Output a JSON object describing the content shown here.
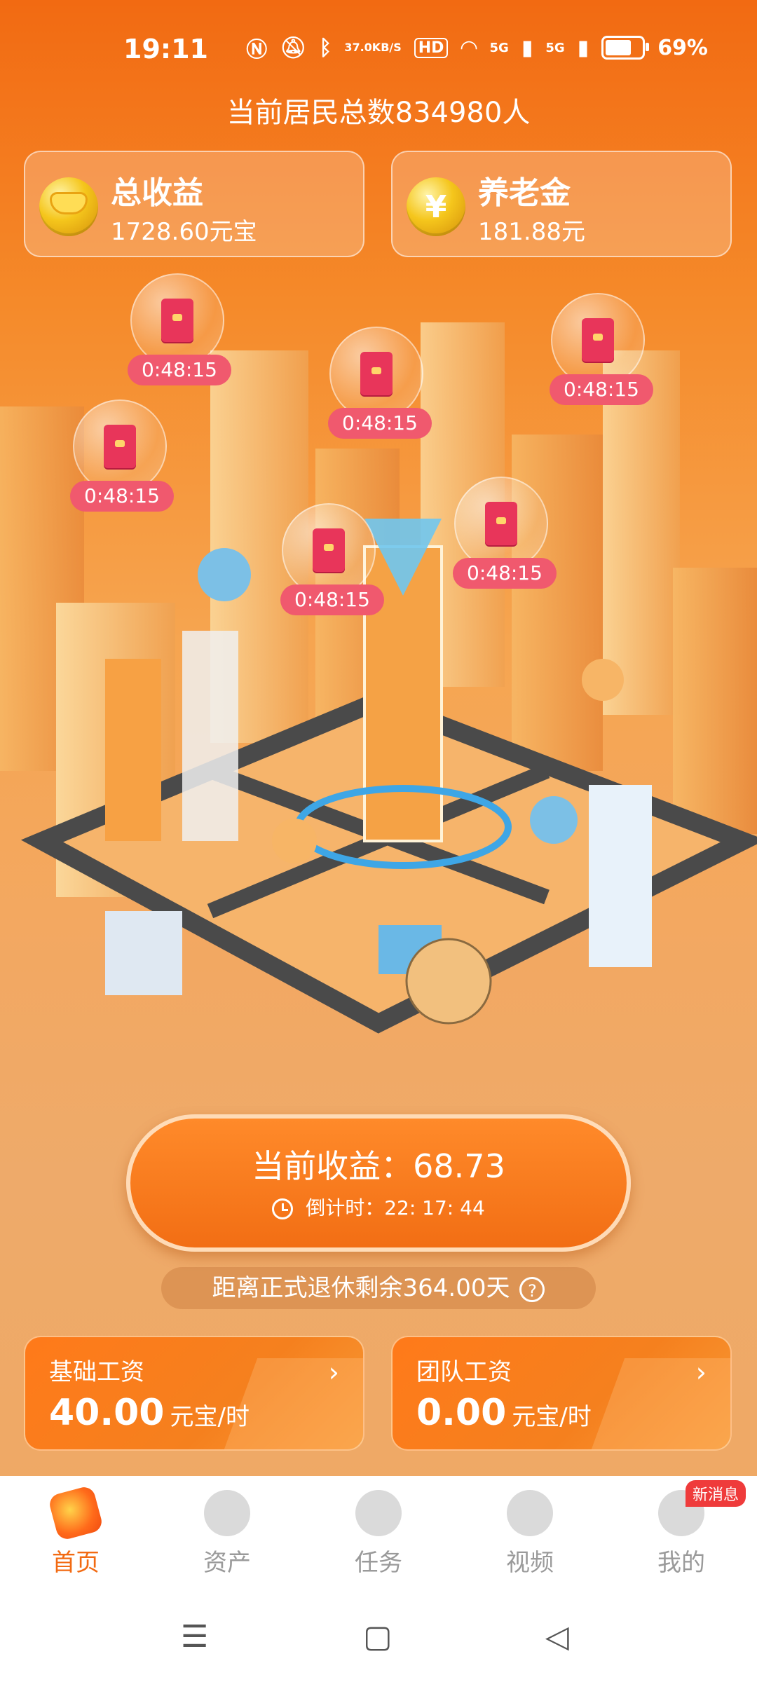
{
  "status_bar": {
    "time": "19:11",
    "net_speed_value": "37.0",
    "net_speed_unit": "KB/S",
    "hd_label": "HD",
    "signal1": "5G",
    "signal2": "5G",
    "battery": "69%"
  },
  "header": {
    "residents_text": "当前居民总数834980人",
    "total_earnings": {
      "title": "总收益",
      "value": "1728.60元宝",
      "icon": "gold-ingot-icon"
    },
    "pension": {
      "title": "养老金",
      "value": "181.88元",
      "icon": "yen-coin-icon"
    }
  },
  "red_packets": [
    {
      "timer": "0:48:15"
    },
    {
      "timer": "0:48:15"
    },
    {
      "timer": "0:48:15"
    },
    {
      "timer": "0:48:15"
    },
    {
      "timer": "0:48:15"
    },
    {
      "timer": "0:48:15"
    }
  ],
  "earnings_button": {
    "label": "当前收益：68.73",
    "countdown_label": "倒计时：22: 17: 44"
  },
  "retirement": {
    "text": "距离正式退休剩余364.00天",
    "help": "?"
  },
  "wages": {
    "basic": {
      "title": "基础工资",
      "value": "40.00",
      "unit": "元宝/时"
    },
    "team": {
      "title": "团队工资",
      "value": "0.00",
      "unit": "元宝/时"
    }
  },
  "tabs": [
    {
      "label": "首页",
      "active": true
    },
    {
      "label": "资产"
    },
    {
      "label": "任务"
    },
    {
      "label": "视频"
    },
    {
      "label": "我的",
      "badge": "新消息"
    }
  ],
  "colors": {
    "accent": "#f26a12",
    "timer_pill": "#f0596e"
  }
}
